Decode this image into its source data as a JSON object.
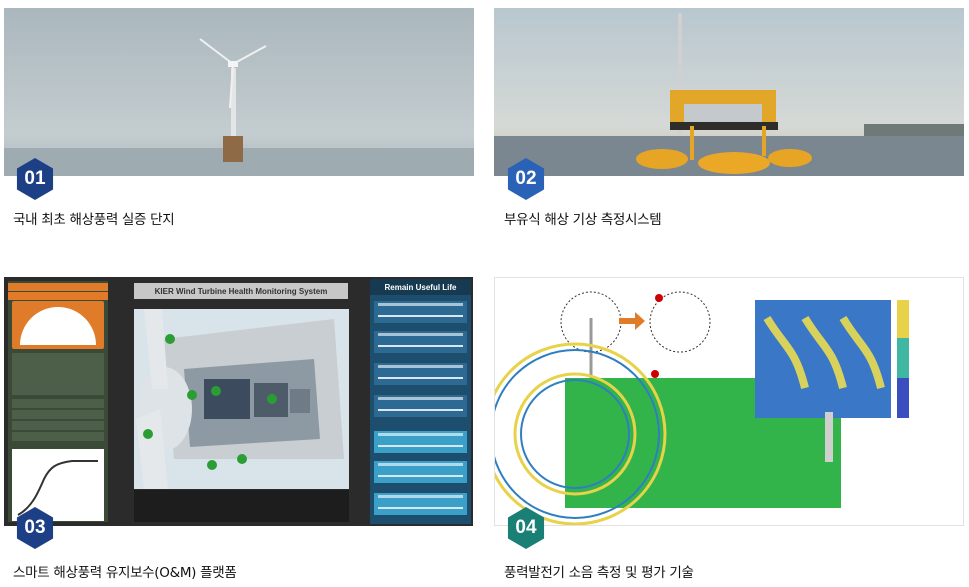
{
  "cards": [
    {
      "number": "01",
      "caption": "국내 최초 해상풍력 실증 단지",
      "badge_color": "#1d3f86",
      "image": "offshore-wind-turbine-photo"
    },
    {
      "number": "02",
      "caption": "부유식 해상 기상 측정시스템",
      "badge_color": "#2a62b8",
      "image": "floating-met-buoy-photo"
    },
    {
      "number": "03",
      "caption": "스마트 해상풍력 유지보수(O&M) 플랫폼",
      "badge_color": "#1d3f86",
      "image": "monitoring-dashboard-screenshot"
    },
    {
      "number": "04",
      "caption": "풍력발전기 소음 측정 및 평가 기술",
      "badge_color": "#1a7f74",
      "image": "noise-simulation-figure"
    }
  ],
  "dashboard": {
    "title": "KIER Wind Turbine Health Monitoring System",
    "right_header": "Remain Useful Life"
  }
}
